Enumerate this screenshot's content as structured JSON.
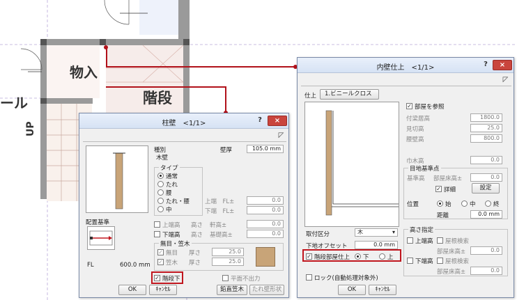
{
  "plan": {
    "room_label": "物入",
    "stairs_label": "階段",
    "hall_label": "ール",
    "up_label": "UP"
  },
  "kabe": {
    "title": "柱壁　<1/1>",
    "help": "?",
    "close": "×",
    "type_label": "種別",
    "type_value": "木壁",
    "thickness_label": "壁厚",
    "thickness_value": "105.0 mm",
    "type_group": "タイプ",
    "radio_normal": "通常",
    "radio_tare": "たれ",
    "radio_koshi": "腰",
    "radio_tarekoshi": "たれ・腰",
    "radio_naka": "中",
    "top_end": "上端　FL±",
    "bottom_end": "下端　FL±",
    "top_end_val": "0.0",
    "bottom_end_val": "0.0",
    "upper_height": "上端高",
    "lower_height": "下端高",
    "takasa1": "高さ",
    "takasa2": "高さ",
    "dokei": "軒高±",
    "kiso": "基礎高±",
    "dokei_val": "0.0",
    "kiso_val": "0.0",
    "group2": "無目・笠木",
    "mume": "無目",
    "kasagi": "笠木",
    "atsusa1": "厚さ",
    "atsusa2": "厚さ",
    "mume_val": "25.0",
    "kasagi_val": "25.0",
    "haichi": "配置基準",
    "fl_label": "FL",
    "fl_value": "600.0 mm",
    "heimen": "平面不出力",
    "kaidan": "階段下",
    "ok": "OK",
    "cancel": "ｷｬﾝｾﾙ",
    "enchoku": "鉛直笠木",
    "tare_shape": "たれ壁形状"
  },
  "naiheki": {
    "title": "内壁仕上　<1/1>",
    "help": "?",
    "close": "×",
    "shiage_label": "仕上",
    "shiage_btn": "1.ビニールクロス",
    "heya": "部屋を参照",
    "tenjo": "付梁居高",
    "mikiri": "見切高",
    "koshi": "腰壁高",
    "tenjo_val": "1800.0",
    "mikiri_val": "25.0",
    "koshi_val": "800.0",
    "habaki": "巾木高",
    "habaki_val": "0.0",
    "mejikijun": "目地基準点",
    "kijun": "基準高",
    "heyayuka": "部屋床高±",
    "kijun_val": "0.0",
    "shosai": "詳細",
    "settei": "設定",
    "ichi": "位置",
    "shi": "始",
    "chu": "中",
    "shu": "終",
    "kyori": "距離",
    "kyori_val": "0.0 mm",
    "toritsuke": "取付区分",
    "toritsuke_val": "木",
    "shita": "下地オフセット",
    "shita_val": "0.0 mm",
    "kaidan_shiage": "階段部屋仕上",
    "shita_opt": "下",
    "ue_opt": "上",
    "takasa_shitei": "高さ指定",
    "uetanda": "上端高",
    "shitatanda": "下端高",
    "yane1": "屋根検索",
    "yane2": "屋根検索",
    "heyayuka1": "部屋床高±",
    "heyayuka2": "部屋床高±",
    "hy1_val": "0.0",
    "hy2_val": "0.0",
    "lock": "ロック(自動処理対象外)",
    "ok": "OK",
    "cancel": "ｷｬﾝｾﾙ"
  },
  "colors": {
    "accent_red": "#c0161e",
    "close_red": "#c9453d",
    "wood": "#c8a478"
  }
}
